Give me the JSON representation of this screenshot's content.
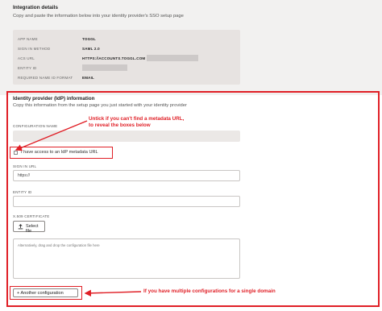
{
  "integration": {
    "title": "Integration details",
    "subtitle": "Copy and paste the information below into your identity provider's SSO setup page",
    "rows": [
      {
        "key": "APP NAME",
        "value": "TOGGL"
      },
      {
        "key": "SIGN IN METHOD",
        "value": "SAML 2.0"
      },
      {
        "key": "ACS URL",
        "value": "HTTPS://ACCOUNTS.TOGGL.COM"
      },
      {
        "key": "ENTITY ID",
        "value": ""
      },
      {
        "key": "REQUIRED NAME ID FORMAT",
        "value": "EMAIL"
      }
    ]
  },
  "idp": {
    "title": "Identity provider (IdP) information",
    "subtitle": "Copy this information from the setup page you just started with your identity provider",
    "config_name_label": "CONFIGURATION NAME",
    "metadata_checkbox_label": "I have access to an IdP metadata URL",
    "sign_in_url_label": "SIGN IN URL",
    "sign_in_url_value": "https://",
    "entity_id_label": "ENTITY ID",
    "cert_label": "X.509 CERTIFICATE",
    "select_file_label": "Select file",
    "dropzone_placeholder": "Alternatively, drag and drop the configuration file here",
    "another_config_label": "+ Another configuration"
  },
  "annotations": {
    "note1_line1": "Untick if you can't find a metadata URL,",
    "note1_line2": "to reveal the boxes below",
    "note2": "If you have multiple configurations for a single domain",
    "color": "#e01f26"
  },
  "icons": [
    "upload-icon",
    "checkbox-icon"
  ]
}
